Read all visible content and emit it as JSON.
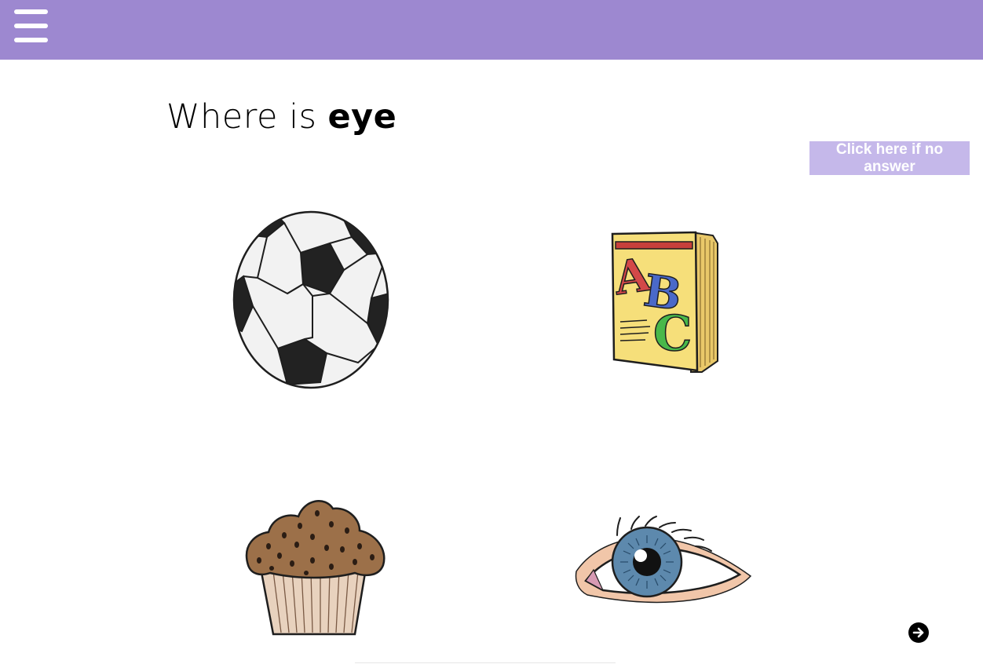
{
  "header": {
    "menu_icon": "hamburger-menu-icon",
    "color": "#9d88d0"
  },
  "prompt": {
    "prefix": "Where is",
    "target_word": "eye"
  },
  "no_answer_button": {
    "label": "Click here if no answer",
    "color": "#c5b8ea"
  },
  "choices": [
    {
      "name": "soccer ball",
      "icon": "soccer-ball-image"
    },
    {
      "name": "ABC book",
      "icon": "abc-book-image"
    },
    {
      "name": "muffin",
      "icon": "muffin-image"
    },
    {
      "name": "eye",
      "icon": "eye-image"
    }
  ],
  "next_button": {
    "icon": "arrow-right-icon"
  }
}
